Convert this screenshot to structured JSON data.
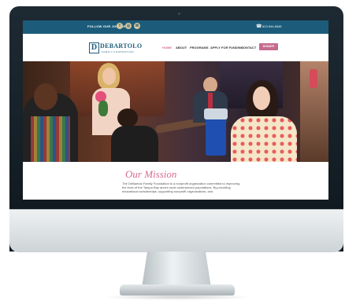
{
  "topbar": {
    "follow_label": "FOLLOW OUR JOURNEY",
    "social_icons": [
      "facebook-icon",
      "instagram-icon",
      "email-icon"
    ],
    "phone": "813.944.8346"
  },
  "brand": {
    "logo_letter": "D",
    "name": "DEBARTOLO",
    "tagline": "FAMILY FOUNDATION"
  },
  "nav": {
    "items": [
      {
        "label": "HOME",
        "active": true
      },
      {
        "label": "ABOUT"
      },
      {
        "label": "PROGRAMS"
      },
      {
        "label": "APPLY FOR FUNDING"
      },
      {
        "label": "CONTACT"
      }
    ],
    "donate_label": "DONATE NOW"
  },
  "mission": {
    "title": "Our Mission",
    "text": "The DeBartolo Family Foundation is a nonprofit organization committed to improving the lives of the Tampa Bay area's most underserved populations. By providing educational scholarships, supporting nonprofit organizations, and"
  },
  "colors": {
    "brand_blue": "#1c5c7a",
    "accent_pink": "#d86d8f",
    "social_gold": "#d8c59a"
  }
}
